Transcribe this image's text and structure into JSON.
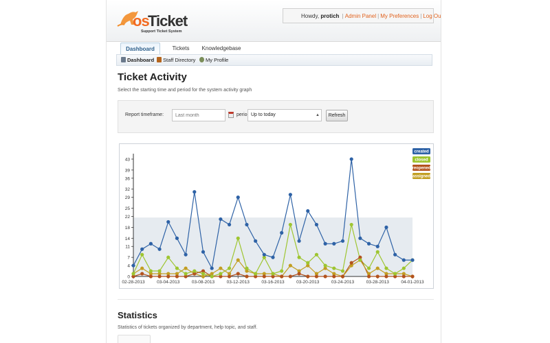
{
  "header": {
    "logo_os": "os",
    "logo_ticket": "Ticket",
    "logo_tagline": "Support Ticket System",
    "greeting": "Howdy,",
    "username": "protich",
    "links": [
      "Admin Panel",
      "My Preferences",
      "Log Out"
    ]
  },
  "tabs": [
    {
      "label": "Dashboard",
      "active": true
    },
    {
      "label": "Tickets",
      "active": false
    },
    {
      "label": "Knowledgebase",
      "active": false
    }
  ],
  "subnav": [
    {
      "label": "Dashboard",
      "icon": "dashboard-icon",
      "color": "#6b7a8c",
      "active": true
    },
    {
      "label": "Staff Directory",
      "icon": "staff-icon",
      "color": "#b5651d",
      "active": false
    },
    {
      "label": "My Profile",
      "icon": "profile-icon",
      "color": "#7b8e5a",
      "active": false
    }
  ],
  "activity": {
    "title": "Ticket Activity",
    "description": "Select the starting time and period for the system activity graph",
    "timeframe_label": "Report timeframe:",
    "timeframe_placeholder": "Last month",
    "period_label": "period:",
    "period_value": "Up to today",
    "refresh_label": "Refresh"
  },
  "statistics": {
    "title": "Statistics",
    "description": "Statistics of tickets organized by department, help topic, and staff."
  },
  "chart_data": {
    "type": "line",
    "x": [
      "02-28-2013",
      "03-01-2013",
      "03-02-2013",
      "03-03-2013",
      "03-04-2013",
      "03-05-2013",
      "03-06-2013",
      "03-07-2013",
      "03-08-2013",
      "03-09-2013",
      "03-10-2013",
      "03-11-2013",
      "03-12-2013",
      "03-13-2013",
      "03-14-2013",
      "03-15-2013",
      "03-16-2013",
      "03-17-2013",
      "03-18-2013",
      "03-19-2013",
      "03-20-2013",
      "03-21-2013",
      "03-22-2013",
      "03-23-2013",
      "03-24-2013",
      "03-25-2013",
      "03-26-2013",
      "03-27-2013",
      "03-28-2013",
      "03-29-2013",
      "03-30-2013",
      "03-31-2013",
      "04-01-2013"
    ],
    "x_tick_labels": [
      "02-28-2013",
      "03-04-2013",
      "03-08-2013",
      "03-12-2013",
      "03-16-2013",
      "03-20-2013",
      "03-24-2013",
      "03-28-2013",
      "04-01-2013"
    ],
    "y_ticks": [
      0,
      4,
      7,
      11,
      14,
      18,
      22,
      25,
      29,
      32,
      36,
      39,
      43
    ],
    "ylim": [
      0,
      45
    ],
    "grid": false,
    "legend_position": "top-right",
    "series": [
      {
        "name": "created",
        "color": "#2e62a6",
        "values": [
          4,
          10,
          12,
          10,
          20,
          14,
          8,
          31,
          9,
          3,
          21,
          19,
          29,
          19,
          13,
          8,
          7,
          16,
          30,
          13,
          24,
          19,
          12,
          12,
          13,
          43,
          14,
          12,
          11,
          18,
          8,
          6,
          6
        ]
      },
      {
        "name": "closed",
        "color": "#9ec530",
        "values": [
          1,
          8,
          2,
          2,
          7,
          3,
          1,
          2,
          1,
          0,
          1,
          3,
          14,
          3,
          1,
          7,
          1,
          2,
          19,
          7,
          5,
          8,
          4,
          3,
          2,
          19,
          6,
          3,
          9,
          3,
          1,
          3,
          6
        ]
      },
      {
        "name": "reopened",
        "color": "#b3531e",
        "values": [
          0,
          1,
          0,
          0,
          0,
          0,
          0,
          1,
          2,
          0,
          0,
          0,
          1,
          0,
          0,
          0,
          0,
          0,
          0,
          1,
          0,
          0,
          0,
          0,
          0,
          5,
          7,
          0,
          0,
          0,
          0,
          0,
          0
        ]
      },
      {
        "name": "assigned",
        "color": "#c29e22",
        "values": [
          1,
          3,
          1,
          1,
          1,
          1,
          3,
          1,
          0,
          1,
          3,
          1,
          6,
          2,
          1,
          1,
          1,
          0,
          4,
          2,
          4,
          1,
          3,
          1,
          0,
          4,
          6,
          1,
          3,
          1,
          1,
          1,
          0
        ]
      }
    ]
  }
}
